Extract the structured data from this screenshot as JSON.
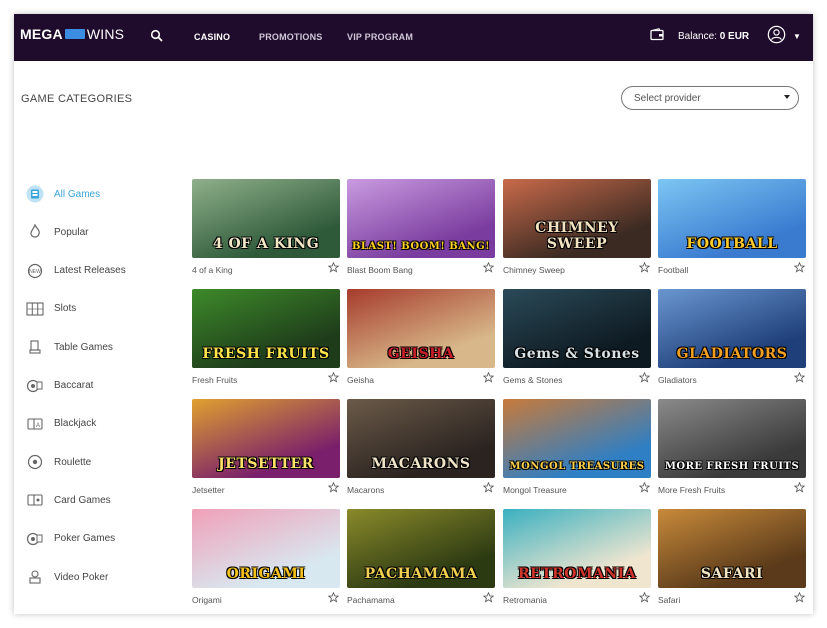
{
  "header": {
    "logo_left": "MEGA",
    "logo_right": "WINS",
    "nav": [
      {
        "label": "CASINO",
        "active": true
      },
      {
        "label": "PROMOTIONS",
        "active": false
      },
      {
        "label": "VIP PROGRAM",
        "active": false
      }
    ],
    "balance_label": "Balance:",
    "balance_value": "0 EUR"
  },
  "main": {
    "categories_title": "GAME CATEGORIES",
    "provider_placeholder": "Select provider"
  },
  "sidebar": {
    "items": [
      {
        "label": "All Games",
        "icon": "all-games-icon"
      },
      {
        "label": "Popular",
        "icon": "popular-icon"
      },
      {
        "label": "Latest Releases",
        "icon": "new-icon"
      },
      {
        "label": "Slots",
        "icon": "slots-icon"
      },
      {
        "label": "Table Games",
        "icon": "table-games-icon"
      },
      {
        "label": "Baccarat",
        "icon": "baccarat-icon"
      },
      {
        "label": "Blackjack",
        "icon": "blackjack-icon"
      },
      {
        "label": "Roulette",
        "icon": "roulette-icon"
      },
      {
        "label": "Card Games",
        "icon": "card-games-icon"
      },
      {
        "label": "Poker Games",
        "icon": "poker-games-icon"
      },
      {
        "label": "Video Poker",
        "icon": "video-poker-icon"
      }
    ]
  },
  "games": [
    {
      "name": "4 of a King",
      "art": "4 OF A KING",
      "bg": "#2f5a3a",
      "bg2": "#8fb08a",
      "fg": "#f2e8c8"
    },
    {
      "name": "Blast Boom Bang",
      "art": "BLAST! BOOM! BANG!",
      "bg": "#7a3c9e",
      "bg2": "#c99be0",
      "fg": "#ffd21f"
    },
    {
      "name": "Chimney Sweep",
      "art": "CHIMNEY SWEEP",
      "bg": "#3a2a22",
      "bg2": "#c96a4a",
      "fg": "#f3e2c0"
    },
    {
      "name": "Football",
      "art": "FOOTBALL",
      "bg": "#3a7bd0",
      "bg2": "#7cc6f3",
      "fg": "#ffcc2a"
    },
    {
      "name": "Fresh Fruits",
      "art": "FRESH FRUITS",
      "bg": "#1e3b1a",
      "bg2": "#3d8a2a",
      "fg": "#ffe44a"
    },
    {
      "name": "Geisha",
      "art": "GEISHA",
      "bg": "#d8b88a",
      "bg2": "#a63b2c",
      "fg": "#c8202a"
    },
    {
      "name": "Gems & Stones",
      "art": "Gems & Stones",
      "bg": "#0e1a22",
      "bg2": "#2a4a58",
      "fg": "#d7e2e8"
    },
    {
      "name": "Gladiators",
      "art": "GLADIATORS",
      "bg": "#1f3f7a",
      "bg2": "#6a97d0",
      "fg": "#f5a020"
    },
    {
      "name": "Jetsetter",
      "art": "JETSETTER",
      "bg": "#7a1f6b",
      "bg2": "#e0a12f",
      "fg": "#ffe36a"
    },
    {
      "name": "Macarons",
      "art": "MACARONS",
      "bg": "#2a2320",
      "bg2": "#6b5a48",
      "fg": "#f0e4c8"
    },
    {
      "name": "Mongol Treasure",
      "art": "MONGOL TREASURES",
      "bg": "#2f7fc4",
      "bg2": "#c87a3a",
      "fg": "#ffd24a"
    },
    {
      "name": "More Fresh Fruits",
      "art": "MORE FRESH FRUITS",
      "bg": "#3a3a3a",
      "bg2": "#8a8a8a",
      "fg": "#ffffff"
    },
    {
      "name": "Origami",
      "art": "ORIGAMI",
      "bg": "#d8e8f0",
      "bg2": "#f0a0b8",
      "fg": "#f5c21c"
    },
    {
      "name": "Pachamama",
      "art": "PACHAMAMA",
      "bg": "#2c3a12",
      "bg2": "#8a8a2a",
      "fg": "#f2d050"
    },
    {
      "name": "Retromania",
      "art": "RETROMANIA",
      "bg": "#f0e6d0",
      "bg2": "#3ab0c0",
      "fg": "#d0342a"
    },
    {
      "name": "Safari",
      "art": "SAFARI",
      "bg": "#5a3a1a",
      "bg2": "#c88a3a",
      "fg": "#f2e4c0"
    }
  ],
  "colors": {
    "header_bg": "#1f0b2b",
    "accent": "#3aa5d8"
  }
}
